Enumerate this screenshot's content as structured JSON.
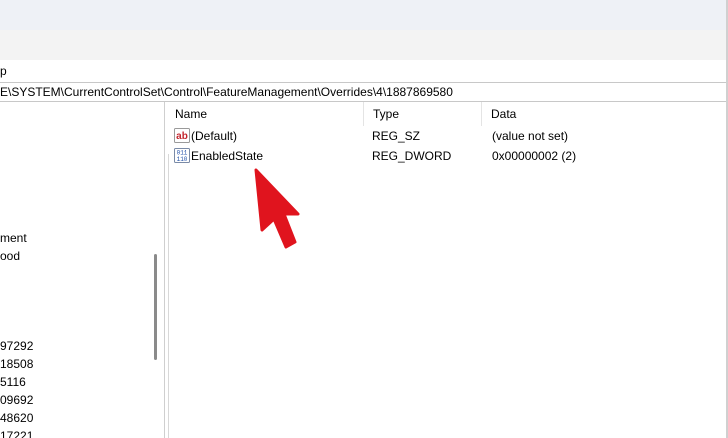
{
  "menu": {
    "visible_item": "p"
  },
  "address": {
    "path": "E\\SYSTEM\\CurrentControlSet\\Control\\FeatureManagement\\Overrides\\4\\1887869580"
  },
  "tree": {
    "items": [
      "ment",
      "ood",
      "97292",
      "18508",
      "5116",
      "09692",
      "48620",
      "17221"
    ]
  },
  "list": {
    "columns": {
      "name": "Name",
      "type": "Type",
      "data": "Data"
    },
    "rows": [
      {
        "name": "(Default)",
        "type": "REG_SZ",
        "data": "(value not set)",
        "icon": "string-value-icon"
      },
      {
        "name": "EnabledState",
        "type": "REG_DWORD",
        "data": "0x00000002 (2)",
        "icon": "binary-value-icon"
      }
    ]
  },
  "annotation": {
    "color": "#e0141e",
    "shape": "pointer-arrow"
  }
}
